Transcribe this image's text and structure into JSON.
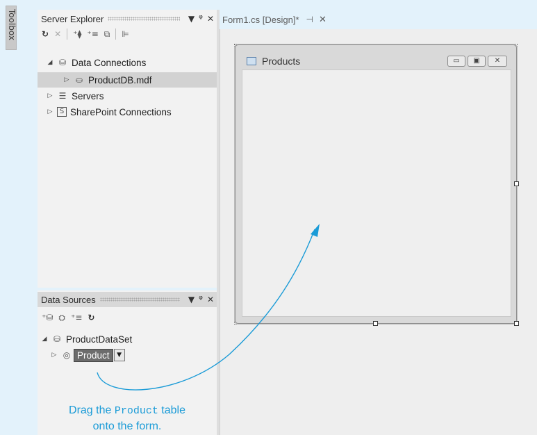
{
  "toolbox": {
    "label": "Toolbox"
  },
  "server_explorer": {
    "title": "Server Explorer",
    "title_buttons": [
      "▼",
      "ᵠ",
      "✕"
    ],
    "tree": [
      {
        "label": "Data Connections",
        "expander": "◢",
        "icon": "data-connections-icon"
      },
      {
        "label": "ProductDB.mdf",
        "expander": "▷",
        "icon": "database-icon",
        "selected": true
      },
      {
        "label": "Servers",
        "expander": "▷",
        "icon": "servers-icon"
      },
      {
        "label": "SharePoint Connections",
        "expander": "▷",
        "icon": "sharepoint-icon"
      }
    ]
  },
  "data_sources": {
    "title": "Data Sources",
    "title_buttons": [
      "▼",
      "ᵠ",
      "✕"
    ],
    "tree": [
      {
        "label": "ProductDataSet",
        "expander": "◢",
        "icon": "dataset-icon"
      },
      {
        "label": "Product",
        "expander": "▷",
        "icon": "table-icon",
        "selected": true
      }
    ]
  },
  "document_tab": {
    "label": "Form1.cs [Design]*",
    "pin": "⊣",
    "close": "✕"
  },
  "form": {
    "title": "Products"
  },
  "callout": {
    "line1_prefix": "Drag the ",
    "line1_code": "Product",
    "line1_suffix": " table",
    "line2": "onto the form."
  },
  "colors": {
    "accent": "#1a9bd7",
    "selection": "#6b6b6b"
  }
}
